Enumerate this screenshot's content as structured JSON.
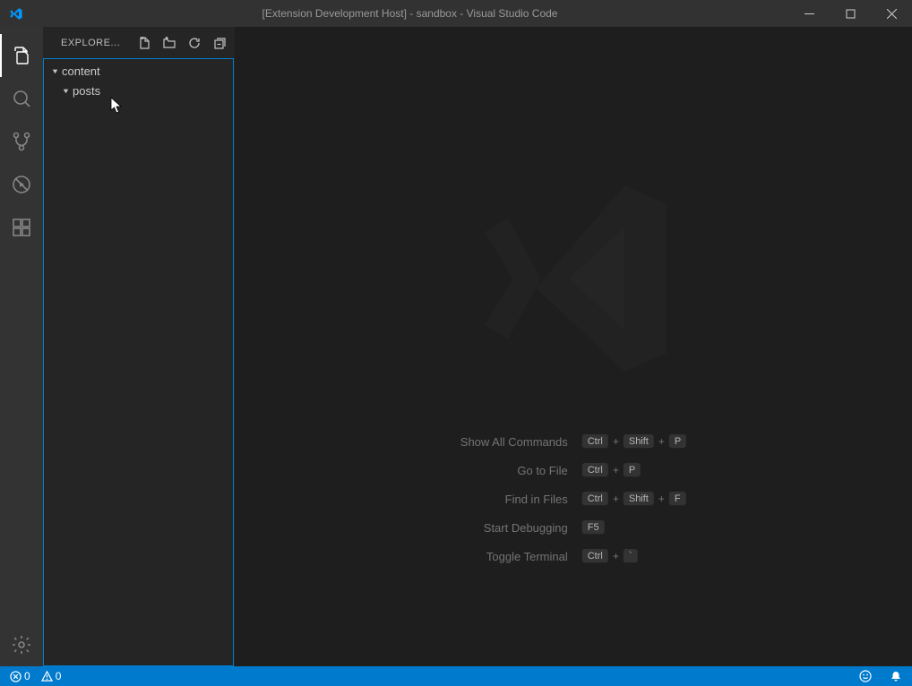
{
  "window": {
    "title": "[Extension Development Host] - sandbox - Visual Studio Code"
  },
  "sidebar": {
    "title": "EXPLORE...",
    "tree": [
      {
        "label": "content",
        "depth": 0
      },
      {
        "label": "posts",
        "depth": 1
      }
    ]
  },
  "welcome": {
    "commands": [
      {
        "label": "Show All Commands",
        "keys": [
          "Ctrl",
          "Shift",
          "P"
        ]
      },
      {
        "label": "Go to File",
        "keys": [
          "Ctrl",
          "P"
        ]
      },
      {
        "label": "Find in Files",
        "keys": [
          "Ctrl",
          "Shift",
          "F"
        ]
      },
      {
        "label": "Start Debugging",
        "keys": [
          "F5"
        ]
      },
      {
        "label": "Toggle Terminal",
        "keys": [
          "Ctrl",
          "`"
        ]
      }
    ]
  },
  "status": {
    "errors": "0",
    "warnings": "0"
  }
}
